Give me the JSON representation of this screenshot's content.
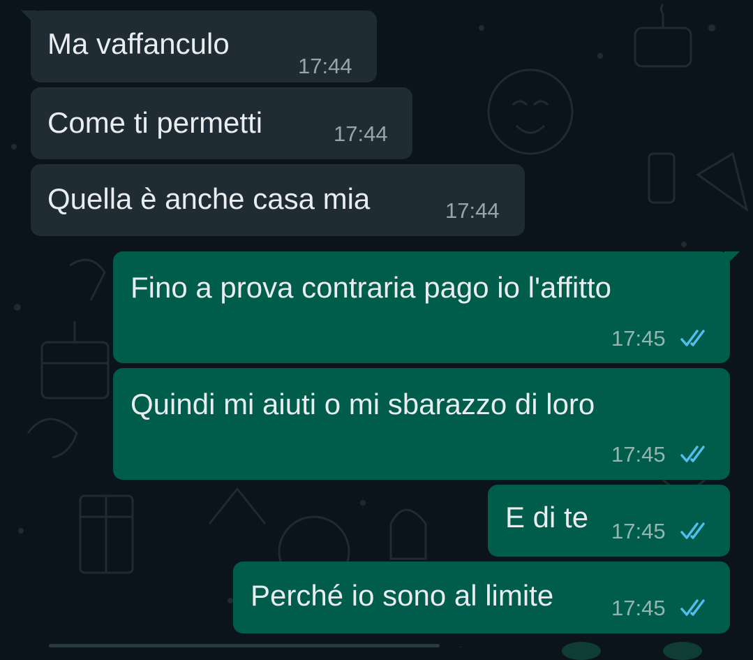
{
  "theme": {
    "background": "#0b141a",
    "incoming_bubble": "#202c33",
    "outgoing_bubble": "#005c4b",
    "read_tick": "#53bdeb"
  },
  "messages": [
    {
      "direction": "incoming",
      "text": "Ma vaffanculo",
      "time": "17:44"
    },
    {
      "direction": "incoming",
      "text": "Come ti permetti",
      "time": "17:44"
    },
    {
      "direction": "incoming",
      "text": "Quella è anche casa mia",
      "time": "17:44"
    },
    {
      "direction": "outgoing",
      "text": "Fino a prova contraria pago io l'affitto",
      "time": "17:45",
      "status": "read-double-tick-icon"
    },
    {
      "direction": "outgoing",
      "text": "Quindi mi aiuti o mi sbarazzo di loro",
      "time": "17:45",
      "status": "read-double-tick-icon"
    },
    {
      "direction": "outgoing",
      "text": "E di te",
      "time": "17:45",
      "status": "read-double-tick-icon"
    },
    {
      "direction": "outgoing",
      "text": "Perché io sono al limite",
      "time": "17:45",
      "status": "read-double-tick-icon"
    }
  ]
}
